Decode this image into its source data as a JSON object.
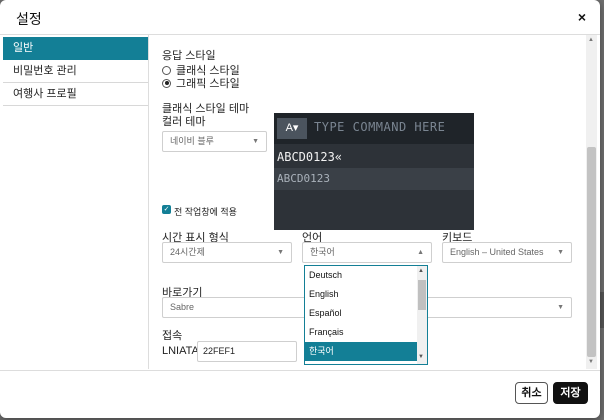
{
  "dialog": {
    "title": "설정",
    "close_symbol": "×"
  },
  "sidebar": {
    "items": [
      {
        "label": "일반",
        "active": true
      },
      {
        "label": "비밀번호 관리",
        "active": false
      },
      {
        "label": "여행사 프로필",
        "active": false
      }
    ]
  },
  "general": {
    "response_style": {
      "label": "응답 스타일",
      "options": [
        {
          "label": "클래식 스타일",
          "checked": false
        },
        {
          "label": "그래픽 스타일",
          "checked": true
        }
      ]
    },
    "classic_theme": {
      "label": "클래식 스타일 테마",
      "color_theme_label": "컬러 테마",
      "color_theme_value": "네이비 블루"
    },
    "command_preview": {
      "toggle": "A▾",
      "placeholder": "TYPE COMMAND HERE",
      "line1": "ABCD0123«",
      "line2": "ABCD0123"
    },
    "apply_all": {
      "label": "전 작업창에 적용",
      "checked": true
    },
    "time_format": {
      "label": "시간 표시 형식",
      "value": "24시간제"
    },
    "language": {
      "label": "언어",
      "value": "한국어",
      "options": [
        "Deutsch",
        "English",
        "Español",
        "Français",
        "한국어"
      ],
      "selected": "한국어"
    },
    "keyboard": {
      "label": "키보드",
      "value": "English – United States"
    },
    "shortcut": {
      "label": "바로가기",
      "value": "Sabre"
    },
    "connection": {
      "label": "접속",
      "lniata_label": "LNIATA",
      "lniata_value": "22FEF1"
    }
  },
  "footer": {
    "cancel_label": "취소",
    "save_label": "저장"
  },
  "colors": {
    "accent": "#137f96",
    "terminal_bg": "#2d3238",
    "primary_button": "#111111"
  }
}
